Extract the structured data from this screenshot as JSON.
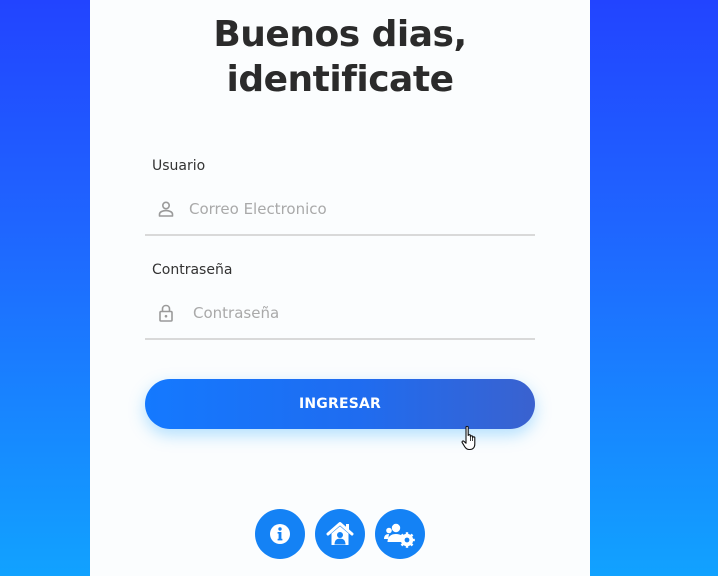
{
  "heading": {
    "line1": "Buenos dias,",
    "line2": "identificate"
  },
  "form": {
    "user": {
      "label": "Usuario",
      "placeholder": "Correo Electronico",
      "icon": "user-icon"
    },
    "password": {
      "label": "Contraseña",
      "placeholder": "Contraseña",
      "icon": "lock-icon"
    },
    "submit_label": "INGRESAR"
  },
  "footer_icons": [
    "info-icon",
    "home-icon",
    "users-settings-icon"
  ],
  "colors": {
    "background_top": "#2244ff",
    "background_bottom": "#11a2ff",
    "card": "#fbfdfe",
    "button_start": "#1479ff",
    "button_end": "#3a62cf",
    "icon_button": "#1482f5",
    "title_text": "#2b2b2b"
  }
}
